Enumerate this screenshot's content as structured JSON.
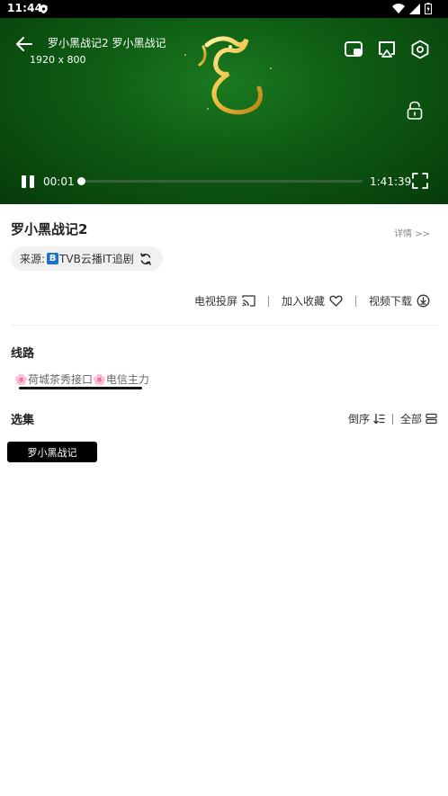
{
  "status_bar": {
    "time": "11:44",
    "icons": [
      "shield-icon",
      "wifi-icon",
      "signal-icon",
      "battery-icon"
    ]
  },
  "player": {
    "title": "罗小黑战记2 罗小黑战记",
    "resolution": "1920 x 800",
    "current_time": "00:01",
    "total_time": "1:41:39",
    "progress": 0.0002,
    "icons": [
      "back-arrow-icon",
      "picture-in-picture-icon",
      "airplay-icon",
      "settings-hexagon-icon",
      "unlock-icon",
      "pause-icon",
      "fullscreen-icon"
    ],
    "background_color": "#0f5d14"
  },
  "info": {
    "title": "罗小黑战记2",
    "detail_link": "详情 >>",
    "source_label": "来源:",
    "source_badge": "B",
    "source_name": "TVB云播IT追剧"
  },
  "actions": {
    "cast": "电视投屏",
    "favorite": "加入收藏",
    "download": "视频下载"
  },
  "routes": {
    "heading": "线路",
    "selected": "🌸荷城茶秀接口🌸电信主力"
  },
  "episodes": {
    "heading": "选集",
    "order": "倒序",
    "all": "全部",
    "items": [
      "罗小黑战记"
    ]
  }
}
